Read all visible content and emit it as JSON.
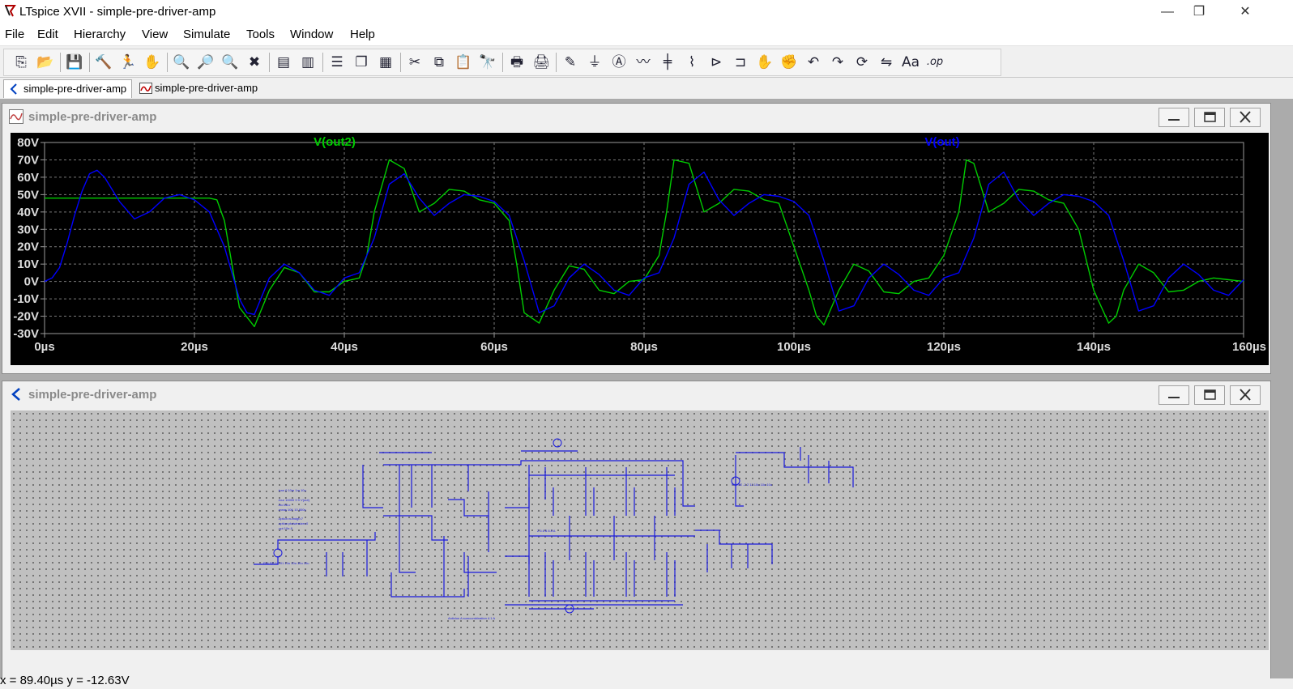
{
  "window": {
    "title": "LTspice XVII - simple-pre-driver-amp",
    "minimize_glyph": "—",
    "restore_glyph": "❐",
    "close_glyph": "✕"
  },
  "menu": [
    "File",
    "Edit",
    "Hierarchy",
    "View",
    "Simulate",
    "Tools",
    "Window",
    "Help"
  ],
  "toolbar_icons": [
    "new-schematic-icon",
    "open-icon",
    "save-icon",
    "control-panel-icon",
    "run-icon",
    "pan-hand-icon",
    "zoom-in-icon",
    "zoom-area-icon",
    "zoom-out-icon",
    "zoom-cancel-icon",
    "autorange-icon",
    "delete-trace-icon",
    "tile-horizontal-icon",
    "cascade-icon",
    "tile-vertical-icon",
    "cut-icon",
    "copy-icon",
    "paste-icon",
    "find-icon",
    "print-preview-icon",
    "print-icon",
    "wire-icon",
    "ground-icon",
    "label-net-icon",
    "resistor-icon",
    "capacitor-icon",
    "inductor-icon",
    "diode-icon",
    "component-icon",
    "move-icon",
    "drag-icon",
    "undo-icon",
    "redo-icon",
    "rotate-icon",
    "mirror-icon",
    "text-icon",
    "spice-directive-icon"
  ],
  "toolbar_extra": {
    "op_label": ".op"
  },
  "tabs": [
    {
      "label": "simple-pre-driver-amp",
      "icon": "schematic-icon",
      "active": true
    },
    {
      "label": "simple-pre-driver-amp",
      "icon": "waveform-icon",
      "active": false
    }
  ],
  "waveform_window": {
    "title": "simple-pre-driver-amp"
  },
  "schematic_window": {
    "title": "simple-pre-driver-amp"
  },
  "chart_data": {
    "type": "line",
    "xlabel": "",
    "ylabel": "",
    "xlim": [
      0,
      160
    ],
    "ylim": [
      -30,
      80
    ],
    "x_tick_labels": [
      "0µs",
      "20µs",
      "40µs",
      "60µs",
      "80µs",
      "100µs",
      "120µs",
      "140µs",
      "160µs"
    ],
    "y_tick_labels": [
      "80V",
      "70V",
      "60V",
      "50V",
      "40V",
      "30V",
      "20V",
      "10V",
      "0V",
      "-10V",
      "-20V",
      "-30V"
    ],
    "grid": true,
    "legend": "top",
    "series": [
      {
        "name": "V(out2)",
        "color": "#00cc00",
        "x": [
          0,
          2,
          4,
          6,
          8,
          10,
          12,
          14,
          16,
          18,
          20,
          22,
          23,
          24,
          26,
          28,
          30,
          32,
          34,
          36,
          38,
          40,
          42,
          43,
          44,
          46,
          48,
          50,
          52,
          54,
          56,
          58,
          60,
          62,
          63,
          64,
          66,
          68,
          70,
          72,
          74,
          76,
          78,
          80,
          82,
          83,
          84,
          86,
          88,
          90,
          92,
          94,
          96,
          98,
          100,
          102,
          103,
          104,
          106,
          108,
          110,
          112,
          114,
          116,
          118,
          120,
          122,
          123,
          124,
          126,
          128,
          130,
          132,
          134,
          136,
          138,
          140,
          142,
          143,
          144,
          146,
          148,
          150,
          152,
          154,
          156,
          158,
          160
        ],
        "y": [
          48,
          48,
          48,
          48,
          48,
          48,
          48,
          48,
          48,
          48,
          48,
          48,
          47,
          35,
          -15,
          -26,
          -5,
          8,
          5,
          -6,
          -6,
          0,
          2,
          15,
          40,
          70,
          65,
          40,
          45,
          53,
          52,
          47,
          45,
          35,
          10,
          -18,
          -24,
          -5,
          9,
          7,
          -5,
          -7,
          0,
          1,
          15,
          40,
          70,
          68,
          40,
          45,
          53,
          52,
          47,
          45,
          20,
          -5,
          -20,
          -25,
          -5,
          10,
          6,
          -6,
          -7,
          0,
          2,
          15,
          40,
          70,
          68,
          40,
          45,
          53,
          52,
          47,
          45,
          30,
          -5,
          -24,
          -20,
          -5,
          10,
          5,
          -6,
          -5,
          0,
          2,
          1,
          0
        ]
      },
      {
        "name": "V(out)",
        "color": "#0000ff",
        "x": [
          0,
          1,
          2,
          3,
          4,
          5,
          6,
          7,
          8,
          10,
          12,
          14,
          16,
          18,
          20,
          22,
          24,
          26,
          27,
          28,
          30,
          32,
          34,
          36,
          38,
          40,
          42,
          44,
          46,
          48,
          50,
          52,
          54,
          56,
          58,
          60,
          62,
          64,
          66,
          68,
          70,
          72,
          74,
          76,
          78,
          80,
          82,
          84,
          86,
          88,
          90,
          92,
          94,
          96,
          98,
          100,
          102,
          104,
          106,
          108,
          110,
          112,
          114,
          116,
          118,
          120,
          122,
          124,
          126,
          128,
          130,
          132,
          134,
          136,
          138,
          140,
          142,
          144,
          146,
          148,
          150,
          152,
          154,
          156,
          158,
          160
        ],
        "y": [
          0,
          2,
          8,
          22,
          38,
          52,
          62,
          64,
          60,
          46,
          36,
          40,
          48,
          50,
          47,
          40,
          20,
          -10,
          -18,
          -19,
          2,
          10,
          5,
          -5,
          -8,
          2,
          5,
          25,
          56,
          62,
          48,
          38,
          45,
          50,
          49,
          46,
          38,
          12,
          -18,
          -14,
          2,
          10,
          4,
          -5,
          -8,
          2,
          5,
          25,
          56,
          63,
          47,
          38,
          45,
          50,
          49,
          46,
          38,
          12,
          -17,
          -14,
          2,
          10,
          4,
          -5,
          -8,
          2,
          5,
          25,
          56,
          63,
          47,
          38,
          45,
          50,
          49,
          46,
          38,
          12,
          -17,
          -14,
          2,
          10,
          4,
          -5,
          -8,
          1
        ]
      }
    ]
  },
  "status": {
    "readout": "x = 89.40µs   y = -12.63V"
  }
}
